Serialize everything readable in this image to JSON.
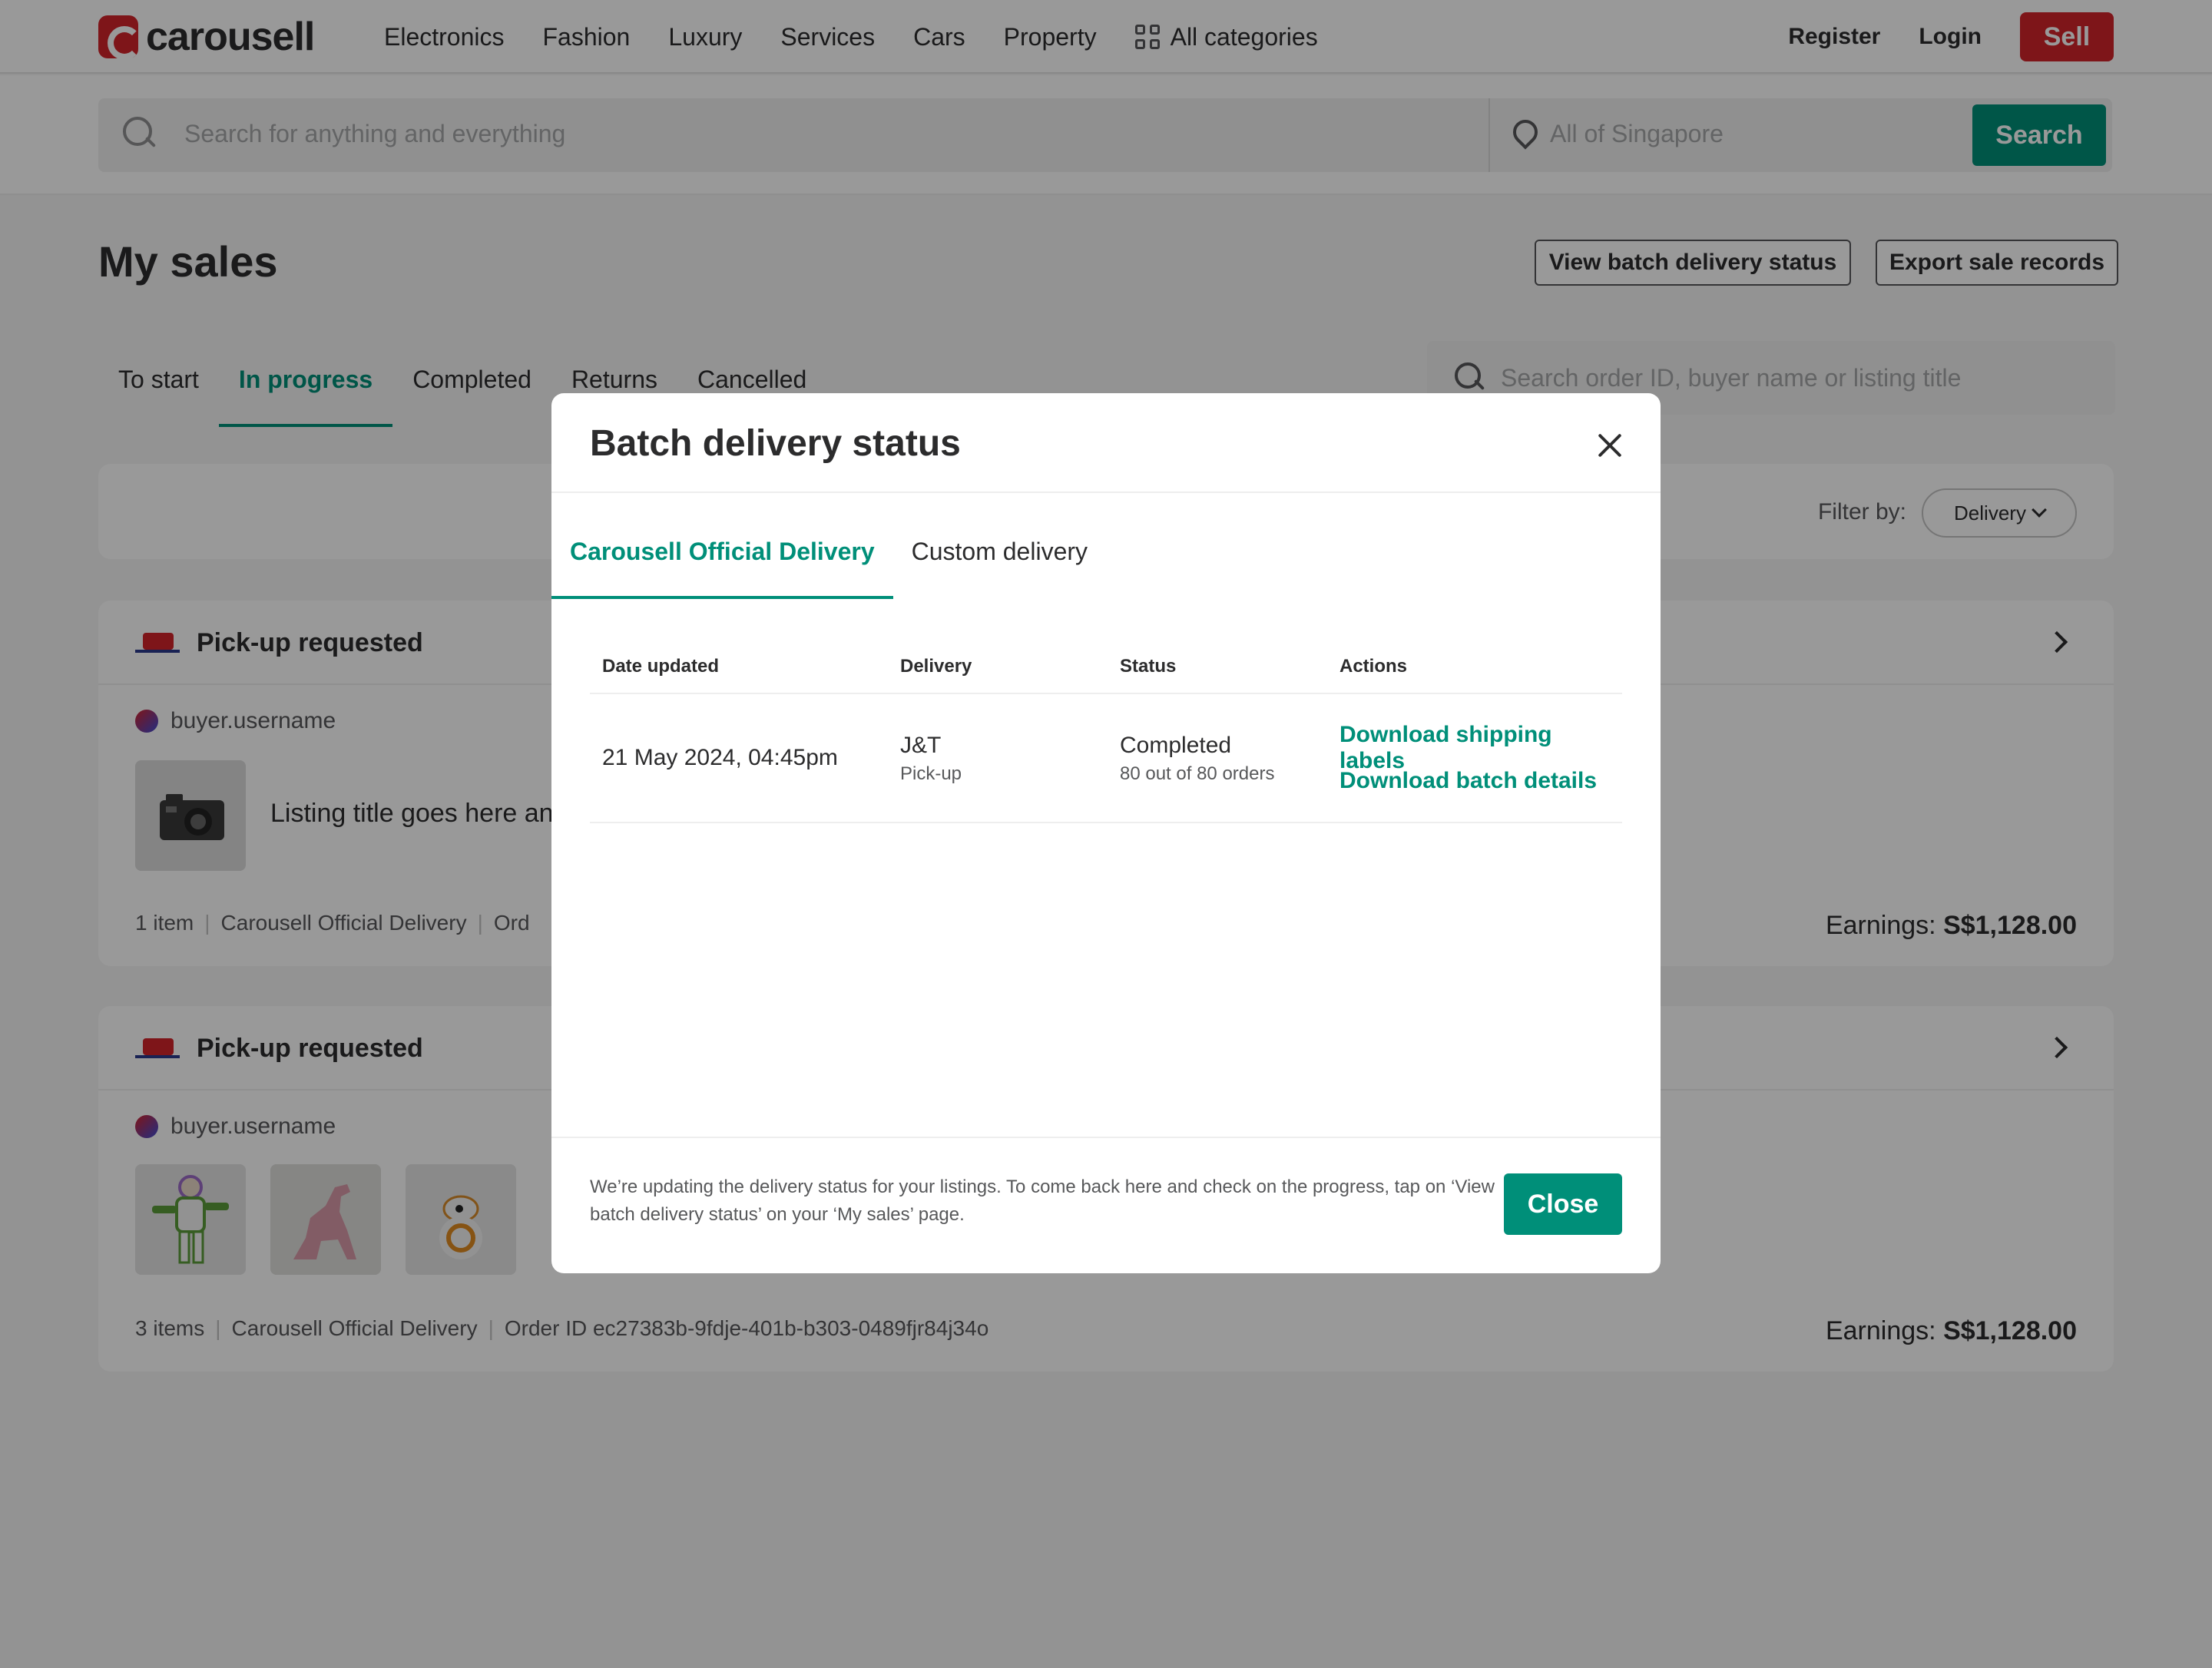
{
  "brand": {
    "logo_text": "carousell",
    "logo_color": "#d2232a"
  },
  "nav": {
    "links": [
      "Electronics",
      "Fashion",
      "Luxury",
      "Services",
      "Cars",
      "Property"
    ],
    "all_categories": "All categories",
    "register": "Register",
    "login": "Login",
    "sell": "Sell"
  },
  "search": {
    "placeholder": "Search for anything and everything",
    "location_placeholder": "All of Singapore",
    "button": "Search"
  },
  "page": {
    "title": "My sales",
    "view_batch_button": "View batch delivery status",
    "export_button": "Export sale records",
    "tabs": [
      "To start",
      "In progress",
      "Completed",
      "Returns",
      "Cancelled"
    ],
    "active_tab": "In progress",
    "order_search_placeholder": "Search order ID, buyer name or listing title",
    "filter_label": "Filter by:",
    "filter_value": "Delivery"
  },
  "orders": [
    {
      "status": "Pick-up requested",
      "buyer": "buyer.username",
      "listing_title": "Listing title goes here an",
      "items": "1 item",
      "delivery": "Carousell Official Delivery",
      "order_id": "Ord",
      "earnings_label": "Earnings:",
      "earnings_value": "S$1,128.00"
    },
    {
      "status": "Pick-up requested",
      "buyer": "buyer.username",
      "items": "3 items",
      "delivery": "Carousell Official Delivery",
      "order_id": "Order ID ec27383b-9fdje-401b-b303-0489fjr84j34o",
      "earnings_label": "Earnings:",
      "earnings_value": "S$1,128.00"
    }
  ],
  "modal": {
    "title": "Batch delivery status",
    "tabs": [
      "Carousell Official Delivery",
      "Custom delivery"
    ],
    "active_tab": "Carousell Official Delivery",
    "columns": [
      "Date updated",
      "Delivery",
      "Status",
      "Actions"
    ],
    "rows": [
      {
        "date": "21 May 2024, 04:45pm",
        "delivery": "J&T",
        "delivery_method": "Pick-up",
        "status": "Completed",
        "status_detail": "80 out of 80 orders",
        "actions": [
          "Download shipping labels",
          "Download batch details"
        ]
      }
    ],
    "footer_note": "We’re updating the delivery status for your listings. To come back here and check on the progress, tap on ‘View batch delivery status’ on your ‘My sales’ page.",
    "close_button": "Close"
  },
  "colors": {
    "accent": "#008f79",
    "brand_red": "#d2232a",
    "overlay": "rgba(0,0,0,0.40)"
  }
}
